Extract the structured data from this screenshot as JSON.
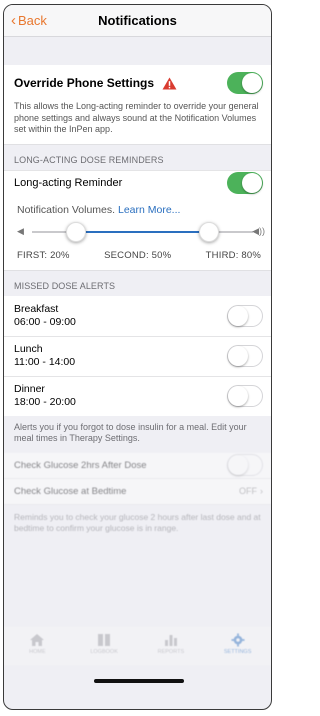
{
  "nav": {
    "back_label": "Back",
    "title": "Notifications"
  },
  "override": {
    "label": "Override Phone Settings",
    "enabled": true,
    "description": "This allows the Long-acting reminder to override your general phone settings and always sound at the Notification Volumes set within the InPen app."
  },
  "long_acting": {
    "header": "LONG-ACTING DOSE REMINDERS",
    "reminder_label": "Long-acting Reminder",
    "enabled": true,
    "volumes_text": "Notification Volumes.",
    "learn_more": "Learn More...",
    "first_label": "FIRST: 20%",
    "second_label": "SECOND: 50%",
    "third_label": "THIRD: 80%",
    "first_value": 20,
    "second_value": 50,
    "third_value": 80
  },
  "missed": {
    "header": "MISSED DOSE ALERTS",
    "meals": [
      {
        "name": "Breakfast",
        "time": "06:00 - 09:00",
        "enabled": false
      },
      {
        "name": "Lunch",
        "time": "11:00 - 14:00",
        "enabled": false
      },
      {
        "name": "Dinner",
        "time": "18:00 - 20:00",
        "enabled": false
      }
    ],
    "footer": "Alerts you if you forgot to dose insulin for a meal. Edit your meal times in Therapy Settings."
  },
  "glucose": {
    "check_after_label": "Check Glucose 2hrs After Dose",
    "check_bedtime_label": "Check Glucose at Bedtime",
    "bedtime_value": "OFF",
    "description": "Reminds you to check your glucose 2 hours after last dose and at bedtime to confirm your glucose is in range."
  },
  "tabs": [
    {
      "label": "HOME",
      "icon": "home-icon"
    },
    {
      "label": "LOGBOOK",
      "icon": "logbook-icon"
    },
    {
      "label": "REPORTS",
      "icon": "reports-icon"
    },
    {
      "label": "SETTINGS",
      "icon": "settings-icon"
    }
  ],
  "colors": {
    "accent": "#e8772e",
    "link": "#2a6fbf",
    "toggle_on": "#4cb25a",
    "warning": "#d93b30"
  }
}
